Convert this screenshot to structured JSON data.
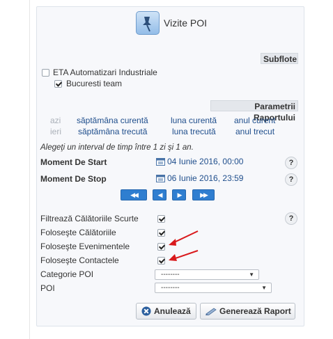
{
  "title": "Vizite POI",
  "sections": {
    "subflote": "Subflote",
    "params": "Parametrii Raportului"
  },
  "fleet": {
    "parent_label": "ETA Automatizari Industriale",
    "parent_checked": false,
    "child_label": "Bucuresti team",
    "child_checked": true
  },
  "periods": {
    "row1": {
      "day": "azi",
      "week": "săptămâna curentă",
      "month": "luna curentă",
      "year": "anul curent"
    },
    "row2": {
      "day": "ieri",
      "week": "săptămâna trecută",
      "month": "luna trecută",
      "year": "anul trecut"
    }
  },
  "hint": "Alegeţi un interval de timp între 1 zi şi 1 an.",
  "start": {
    "label": "Moment De Start",
    "value": "04 Iunie 2016, 00:00"
  },
  "stop": {
    "label": "Moment De Stop",
    "value": "06 Iunie 2016, 23:59"
  },
  "nav": {
    "first": "◀◀",
    "prev": "◀",
    "next": "▶",
    "last": "▶▶"
  },
  "options": [
    {
      "label": "Filtrează Călătoriile Scurte",
      "checked": true
    },
    {
      "label": "Foloseşte Călătoriile",
      "checked": true
    },
    {
      "label": "Foloseşte Evenimentele",
      "checked": true
    },
    {
      "label": "Foloseşte Contactele",
      "checked": true
    }
  ],
  "category": {
    "label": "Categorie POI",
    "value": "--------"
  },
  "poi": {
    "label": "POI",
    "value": "--------"
  },
  "help": "?",
  "buttons": {
    "cancel": "Anulează",
    "generate": "Generează Raport"
  },
  "icons": [
    "pushpin-icon",
    "calendar-icon",
    "help-icon",
    "cancel-icon",
    "pencil-icon",
    "red-arrow-icon"
  ],
  "colors": {
    "link": "#1f4e8c",
    "nav_button": "#2f7ed0",
    "annotation_arrow": "#d9191c"
  }
}
